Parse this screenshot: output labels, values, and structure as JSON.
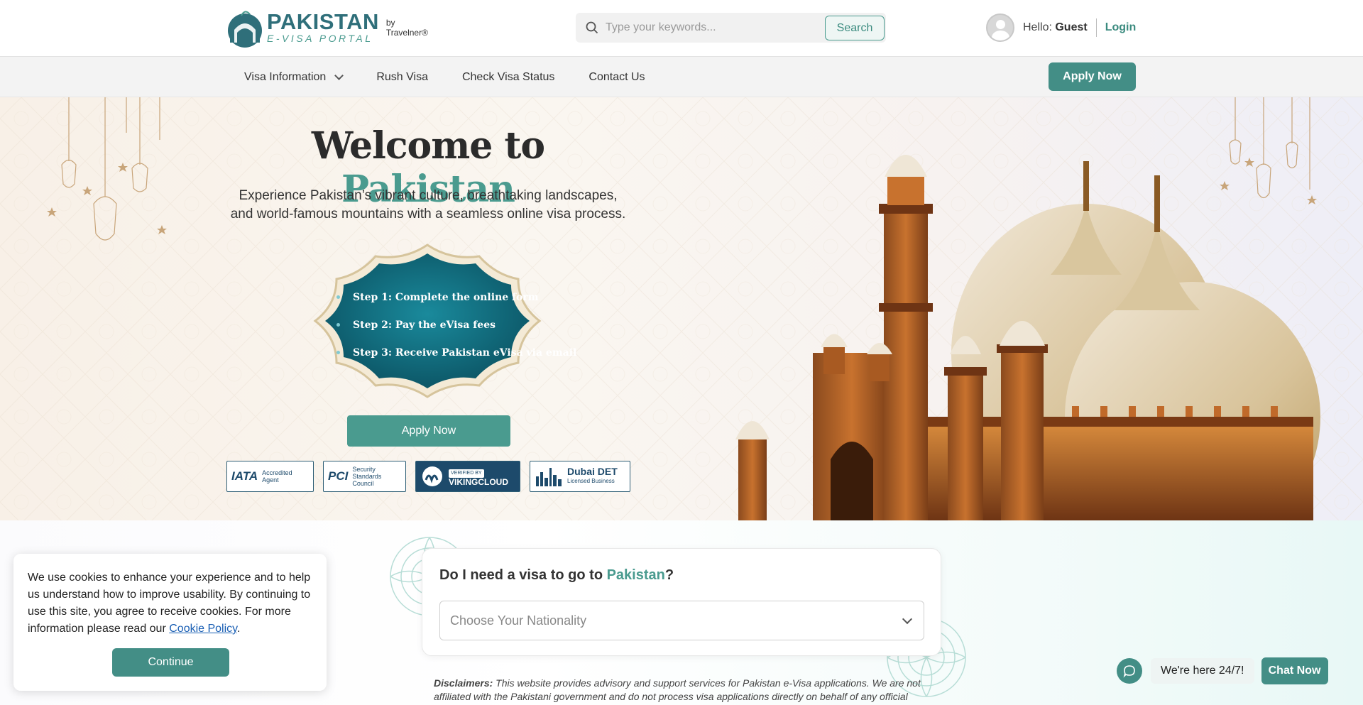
{
  "header": {
    "logo_main": "PAKISTAN",
    "logo_sub": "E-VISA PORTAL",
    "logo_by": "by",
    "logo_by_brand": "Travelnеr®",
    "search_placeholder": "Type your keywords...",
    "search_button": "Search",
    "greeting": "Hello:",
    "user": "Guest",
    "login": "Login"
  },
  "nav": {
    "items": [
      {
        "label": "Visa Information"
      },
      {
        "label": "Rush Visa"
      },
      {
        "label": "Check Visa Status"
      },
      {
        "label": "Contact Us"
      }
    ],
    "apply": "Apply Now"
  },
  "hero": {
    "title_prefix": "Welcome to ",
    "title_highlight": "Pakistan",
    "description": "Experience Pakistan’s vibrant culture, breathtaking landscapes, and world-famous mountains with a seamless online visa process.",
    "steps": [
      "Step 1: Complete the online form",
      "Step 2: Pay the eVisa fees",
      "Step 3: Receive Pakistan eVisa via email"
    ],
    "apply": "Apply Now",
    "certs": {
      "iata": "IATA",
      "iata_sub": "Accredited Agent",
      "pci": "PCI",
      "pci_sub": "Security Standards Council",
      "viking": "VIKINGCLOUD",
      "viking_sub": "VERIFIED BY",
      "dubai": "Dubai DET",
      "dubai_sub": "Licensed Business"
    }
  },
  "visa_check": {
    "question_prefix": "Do I need a visa to go to ",
    "question_highlight": "Pakistan",
    "question_suffix": "?",
    "select_placeholder": "Choose Your Nationality"
  },
  "disclaimer": {
    "label": "Disclaimers:",
    "text": " This website provides advisory and support services for Pakistan e-Visa applications. We are not affiliated with the Pakistani government and do not process visa applications directly on behalf of any official"
  },
  "cookie": {
    "text": "We use cookies to enhance your experience and to help us understand how to improve usability. By continuing to use this site, you agree to receive cookies. For more information please read our ",
    "link": "Cookie Policy",
    "end": ".",
    "button": "Continue"
  },
  "chat": {
    "text": "We're here 24/7!",
    "button": "Chat Now"
  },
  "colors": {
    "accent": "#4a9b8f",
    "button": "#438e86",
    "brand_dark": "#2f6f7a"
  }
}
